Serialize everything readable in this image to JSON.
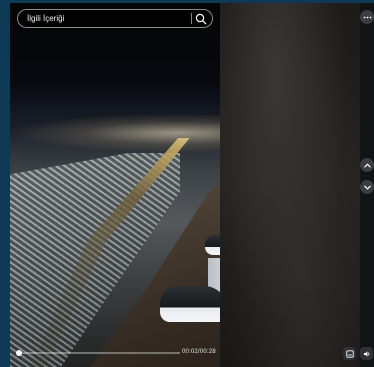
{
  "search": {
    "label": "İlgili İçeriği"
  },
  "player": {
    "time": "00:02/00:28",
    "progress": 0.02
  },
  "icons": {
    "search": "search-icon",
    "more": "more-dots-icon",
    "prev": "chevron-up-icon",
    "next": "chevron-down-icon",
    "captions": "captions-icon",
    "volume": "volume-icon"
  }
}
